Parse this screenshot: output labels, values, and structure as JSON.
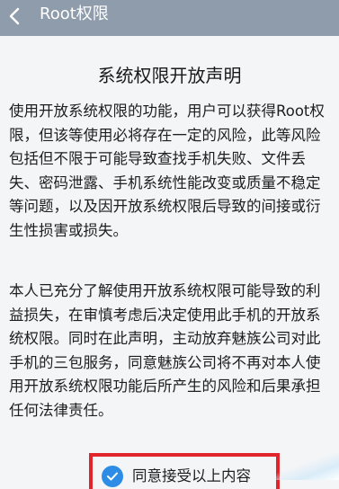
{
  "header": {
    "title": "Root权限",
    "back_icon": "chevron-left-icon",
    "background": "#8f9cab"
  },
  "notice": {
    "title": "系统权限开放声明",
    "paragraph1": [
      "使用开放系统权限的功能，用户可以获得Root权",
      "限，但该等使用必将存在一定的风险，此等风险",
      "包括但不限于可能导致查找手机失败、文件丢",
      "失、密码泄露、手机系统性能改变或质量不稳定",
      "等问题，以及因开放系统权限后导致的间接或衍",
      "生性损害或损失。"
    ],
    "paragraph2": [
      "本人已充分了解使用开放系统权限可能导致的利",
      "益损失，在审慎考虑后决定使用此手机的开放系",
      "统权限。同时在此声明，主动放弃魅族公司对此",
      "手机的三包服务，同意魅族公司将不再对本人使",
      "用开放系统权限功能后所产生的风险和后果承担",
      "任何法律责任。"
    ]
  },
  "agreement": {
    "label": "同意接受以上内容",
    "checked": true,
    "check_icon": "checkmark-icon",
    "check_color": "#2d8de6",
    "highlight_color": "#e2252d"
  }
}
